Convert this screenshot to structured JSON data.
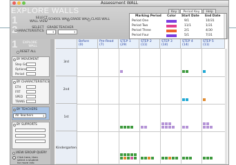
{
  "window": {
    "title": "Assessment WALL"
  },
  "header": {
    "brand": "EXPLORE WALLS",
    "step1": "1",
    "step2": "2",
    "step3": "3",
    "select_wall_view": "SELECT\nWALL VIEW",
    "view_options": [
      {
        "label": "SCHOOL WALL",
        "selected": false
      },
      {
        "label": "GRADE WALL",
        "selected": true
      },
      {
        "label": "CLASS WALL",
        "selected": false
      }
    ],
    "select_characteristics": "SELECT\nCHARACTERISTICS",
    "grade_label": "GRADE",
    "teacher_label": "TEACHER"
  },
  "tabs": [
    {
      "label": "Key",
      "active": false
    },
    {
      "label": "Period Key",
      "active": true
    },
    {
      "label": "Help",
      "active": false
    }
  ],
  "period_key": {
    "headers": [
      "Marking Period",
      "Color",
      "Start Date",
      "End Date"
    ],
    "rows": [
      {
        "name": "Period One",
        "color": "#7a3ce0",
        "start": "9/1",
        "end": "10/31"
      },
      {
        "name": "Period Two",
        "color": "#e23d8f",
        "start": "11/1",
        "end": "1/31"
      },
      {
        "name": "Period Three",
        "color": "#f0612d",
        "start": "2/1",
        "end": "4/30"
      },
      {
        "name": "Period Four",
        "color": "#7a3ce0",
        "start": "5/1",
        "end": "7/31"
      }
    ]
  },
  "sidebar": {
    "explore_wall": "EXPLORE\nWALL",
    "reset_all": "RESET ALL",
    "by_movement": "BY MOVEMENT",
    "movement_fields": [
      "Step Gain",
      "Options",
      "Period"
    ],
    "by_characteristics": "BY CHARACTERISTICS",
    "characteristic_fields": [
      "ETH",
      "FRT",
      "SPED",
      "TRANS"
    ],
    "by_teachers": "BY TEACHERS",
    "teacher_select": "All Teachers",
    "by_supports": "BY SUPPORTS",
    "view_group_query": "VIEW GROUP QUERY",
    "hint": "Click here, then select a student for more info"
  },
  "grid": {
    "columns": [
      "Before\n(0)",
      "Pre-Read\n(7)",
      "STEP 1\n(29)",
      "STEP 2\n(11)",
      "STEP 3\n(14)",
      "STEP 4\n(14)",
      "STEP 5\n(11)"
    ],
    "rows": [
      "3rd",
      "2nd",
      "1st",
      "Kindergarten"
    ]
  },
  "colors": {
    "green": "#3e9a3e",
    "purple": "#b493d6",
    "cyan": "#1fa8d4",
    "orange": "#e08a2e",
    "pink": "#d05aa0",
    "header_bg": "#e7f0fb"
  }
}
